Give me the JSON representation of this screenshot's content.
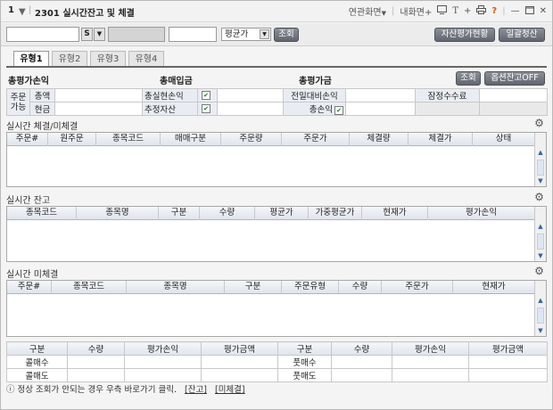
{
  "titlebar": {
    "screen_num": "1",
    "title": "2301 실시간잔고 및 체결",
    "related": "연관화면",
    "my_screen": "내화면+",
    "plus": "+",
    "help": "?"
  },
  "toolbar": {
    "s_label": "S",
    "price_select": "평균가",
    "query_btn": "조회",
    "asset_eval_btn": "자산평가현황",
    "batch_settle_btn": "일괄청산"
  },
  "tabs": [
    {
      "label": "유형1",
      "active": true
    },
    {
      "label": "유형2",
      "active": false
    },
    {
      "label": "유형3",
      "active": false
    },
    {
      "label": "유형4",
      "active": false
    }
  ],
  "summary": {
    "total_pnl": "총평가손익",
    "total_buy": "총매입금",
    "total_eval": "총평가금",
    "query_btn": "조회",
    "option_btn": "옵션잔고OFF"
  },
  "info": {
    "order": "주문",
    "avail": "가능",
    "total_amt": "총액",
    "cash": "현금",
    "realized_pnl": "총실현손익",
    "est_asset": "추정자산",
    "prev_day_pnl": "전일대비손익",
    "total_pnl": "총손익",
    "est_fee": "잠정수수료"
  },
  "sections": {
    "exec": {
      "title": "실시간 체결/미체결",
      "columns": [
        "주문#",
        "원주문",
        "종목코드",
        "매매구분",
        "주문량",
        "주문가",
        "체결량",
        "체결가",
        "상태"
      ]
    },
    "balance": {
      "title": "실시간 잔고",
      "columns": [
        "종목코드",
        "종목명",
        "구분",
        "수량",
        "평균가",
        "가중평균가",
        "현재가",
        "평가손익"
      ]
    },
    "unfilled": {
      "title": "실시간 미체결",
      "columns": [
        "주문#",
        "종목코드",
        "종목명",
        "구분",
        "주문유형",
        "수량",
        "주문가",
        "현재가"
      ]
    }
  },
  "bottom": {
    "headers": [
      "구분",
      "수량",
      "평가손익",
      "평가금액",
      "구분",
      "수량",
      "평가손익",
      "평가금액"
    ],
    "rows": [
      [
        "콜매수",
        "",
        "",
        "",
        "풋매수",
        "",
        "",
        ""
      ],
      [
        "콜매도",
        "",
        "",
        "",
        "풋매도",
        "",
        "",
        ""
      ]
    ]
  },
  "footer": {
    "notice": "정상 조회가 안되는 경우 우측 바로가기 클릭.",
    "link_balance": "[잔고]",
    "link_unfilled": "[미체결]"
  }
}
